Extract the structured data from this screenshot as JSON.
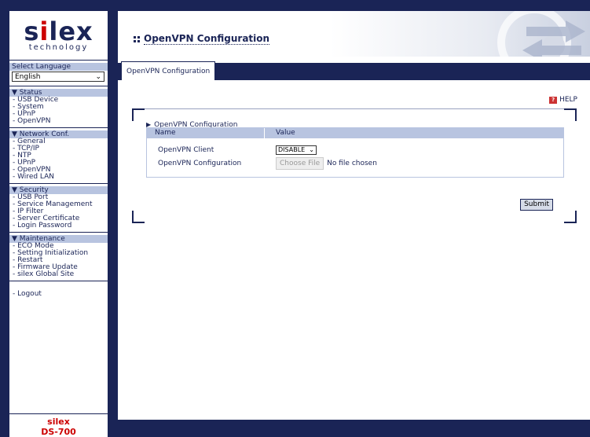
{
  "logo": {
    "brand_pre": "s",
    "brand_i": "i",
    "brand_post": "lex",
    "sub": "technology"
  },
  "language": {
    "label": "Select Language",
    "value": "English"
  },
  "sections": [
    {
      "title": "▼ Status",
      "items": [
        "- USB Device",
        "- System",
        "- UPnP",
        "- OpenVPN"
      ]
    },
    {
      "title": "▼ Network Conf.",
      "items": [
        "- General",
        "- TCP/IP",
        "- NTP",
        "- UPnP",
        "- OpenVPN",
        "- Wired LAN"
      ]
    },
    {
      "title": "▼ Security",
      "items": [
        "- USB Port",
        "- Service Management",
        "- IP Filter",
        "- Server Certificate",
        "- Login Password"
      ]
    },
    {
      "title": "▼ Maintenance",
      "items": [
        "- ECO Mode",
        "- Setting Initialization",
        "- Restart",
        "- Firmware Update",
        "- silex Global Site"
      ]
    }
  ],
  "logout": "- Logout",
  "footer": {
    "line1": "silex",
    "line2": "DS-700"
  },
  "header": {
    "title": "OpenVPN Configuration"
  },
  "tab": {
    "label": "OpenVPN Configuration"
  },
  "help": {
    "label": "HELP"
  },
  "group": {
    "title": "OpenVPN Configuration"
  },
  "table": {
    "headers": [
      "Name",
      "Value"
    ],
    "rows": [
      {
        "name": "OpenVPN Client",
        "select_value": "DISABLE"
      },
      {
        "name": "OpenVPN Configuration",
        "button": "Choose File",
        "status": "No file chosen"
      }
    ]
  },
  "submit": "Submit",
  "colors": {
    "navy": "#1a2456",
    "accent_red": "#cc0000",
    "header_fill": "#b8c4e0"
  }
}
